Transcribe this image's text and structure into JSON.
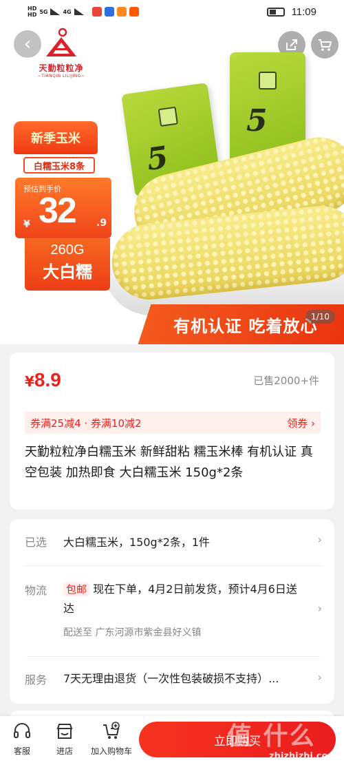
{
  "status_bar": {
    "network_1": "HD",
    "network_2": "HD",
    "net_type": "5G",
    "net_type2": "4G",
    "time": "11:09"
  },
  "hero": {
    "brand_name": "天勤粒粒净",
    "brand_sub": "~TIANQIN LILIJING~",
    "promo_title": "新季玉米",
    "promo_sub": "白糯玉米8条",
    "est_price_label": "预估到手价",
    "est_price_symbol": "¥",
    "est_price_int": "32",
    "est_price_dec": ".9",
    "weight": "260G",
    "variety": "大白糯",
    "bag_number": "5",
    "slogan": "有机认证 吃着放心",
    "image_counter": "1/10",
    "brand_color": "#d9232a"
  },
  "product": {
    "price_symbol": "¥",
    "price": "8.9",
    "sold": "已售2000+件",
    "coupons": "券满25减4 · 券满10减2",
    "get_coupon": "领券",
    "title": "天勤粒粒净白糯玉米 新鲜甜粘 糯玉米棒 有机认证 真空包装 加热即食 大白糯玉米 150g*2条",
    "accent_color": "#e8231c"
  },
  "details": {
    "selected_label": "已选",
    "selected_value": "大白糯玉米，150g*2条，1件",
    "shipping_label": "物流",
    "shipping_badge": "包邮",
    "shipping_value": "现在下单，4月2日前发货，预计4月6日送达",
    "ship_to": "配送至  广东河源市紫金县好义镇",
    "service_label": "服务",
    "service_value": "7天无理由退货（一次性包装破损不支持）..."
  },
  "bottom_bar": {
    "service": "客服",
    "shop": "进店",
    "add_cart": "加入购物车",
    "buy_now": "立即购买",
    "watermark": "值 什么值得买",
    "watermark_url": "zhizhizhi.com"
  },
  "icons": [
    "back-icon",
    "share-icon",
    "cart-icon",
    "headset-icon",
    "store-icon",
    "add-cart-icon",
    "chevron-right-icon"
  ]
}
